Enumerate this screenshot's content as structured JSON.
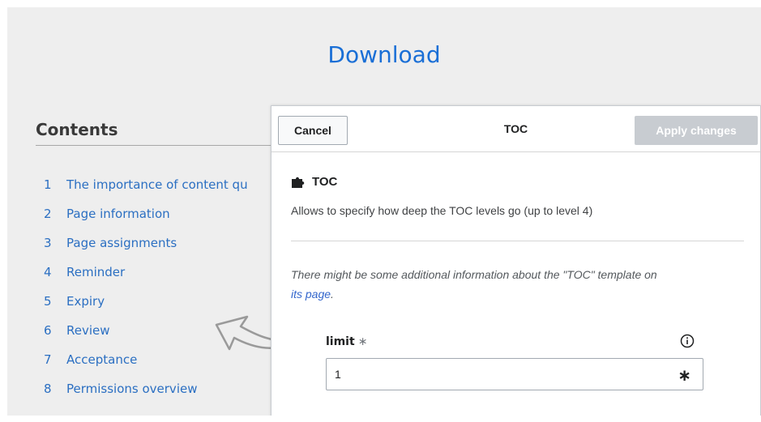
{
  "page": {
    "download_label": "Download",
    "contents_title": "Contents",
    "toc_items": [
      {
        "num": "1",
        "label": "The importance of content qu"
      },
      {
        "num": "2",
        "label": "Page information"
      },
      {
        "num": "3",
        "label": "Page assignments"
      },
      {
        "num": "4",
        "label": "Reminder"
      },
      {
        "num": "5",
        "label": "Expiry"
      },
      {
        "num": "6",
        "label": "Review"
      },
      {
        "num": "7",
        "label": "Acceptance"
      },
      {
        "num": "8",
        "label": "Permissions overview"
      }
    ]
  },
  "dialog": {
    "cancel_label": "Cancel",
    "title": "TOC",
    "apply_label": "Apply changes",
    "template_name": "TOC",
    "template_description": "Allows to specify how deep the TOC levels go (up to level 4)",
    "note_text": "There might be some additional information about the \"TOC\" template on",
    "note_link": "its page",
    "note_end": ".",
    "param_label": "limit",
    "required_marker": "∗",
    "limit_value": "1",
    "input_marker": "∗"
  },
  "icons": {
    "template": "puzzle-piece-icon",
    "info": "info-icon",
    "arrow": "arrow-pointer-icon"
  },
  "colors": {
    "link": "#1a6fd6",
    "apply_disabled": "#c8ccd1"
  }
}
